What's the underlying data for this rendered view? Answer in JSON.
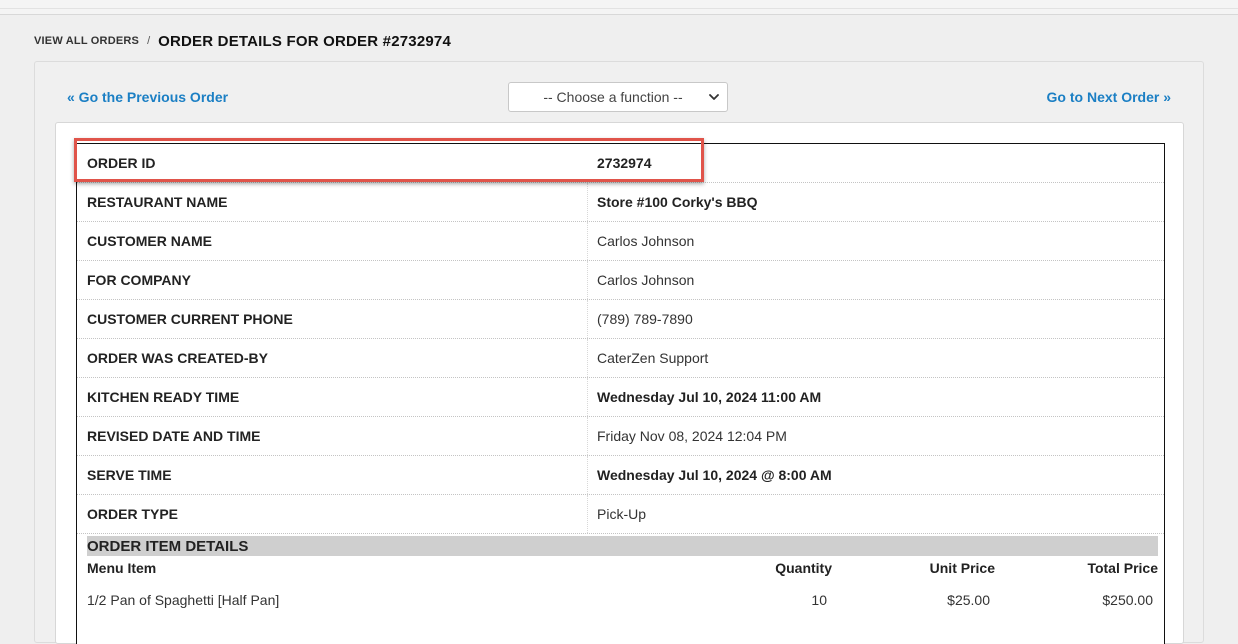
{
  "breadcrumb": {
    "link": "VIEW ALL ORDERS",
    "separator": "/",
    "title": "ORDER DETAILS FOR ORDER #2732974"
  },
  "nav": {
    "previous": "« Go the Previous Order",
    "next": "Go to Next Order »"
  },
  "function_select": {
    "selected": "-- Choose a function --"
  },
  "details": [
    {
      "label": "ORDER ID",
      "value": "2732974",
      "bold": true
    },
    {
      "label": "RESTAURANT NAME",
      "value": "Store #100 Corky's BBQ",
      "bold": true
    },
    {
      "label": "CUSTOMER NAME",
      "value": "Carlos Johnson",
      "bold": false
    },
    {
      "label": "FOR COMPANY",
      "value": "Carlos Johnson",
      "bold": false
    },
    {
      "label": "CUSTOMER CURRENT PHONE",
      "value": "(789) 789-7890",
      "bold": false
    },
    {
      "label": "ORDER WAS CREATED-BY",
      "value": "CaterZen Support",
      "bold": false
    },
    {
      "label": "KITCHEN READY TIME",
      "value": "Wednesday Jul 10, 2024 11:00 AM",
      "bold": true
    },
    {
      "label": "REVISED DATE AND TIME",
      "value": "Friday Nov 08, 2024 12:04 PM",
      "bold": false
    },
    {
      "label": "SERVE TIME",
      "value": "Wednesday Jul 10, 2024 @ 8:00 AM",
      "bold": true
    },
    {
      "label": "ORDER TYPE",
      "value": "Pick-Up",
      "bold": false
    }
  ],
  "items_section": {
    "title": "ORDER ITEM DETAILS",
    "columns": [
      "Menu Item",
      "Quantity",
      "Unit Price",
      "Total Price"
    ],
    "rows": [
      {
        "menu_item": "1/2 Pan of Spaghetti [Half Pan]",
        "quantity": "10",
        "unit_price": "$25.00",
        "total_price": "$250.00"
      }
    ]
  },
  "colors": {
    "link": "#1b7fc4",
    "highlight": "#e0544a",
    "section_header_bg": "#cfcfcf"
  }
}
